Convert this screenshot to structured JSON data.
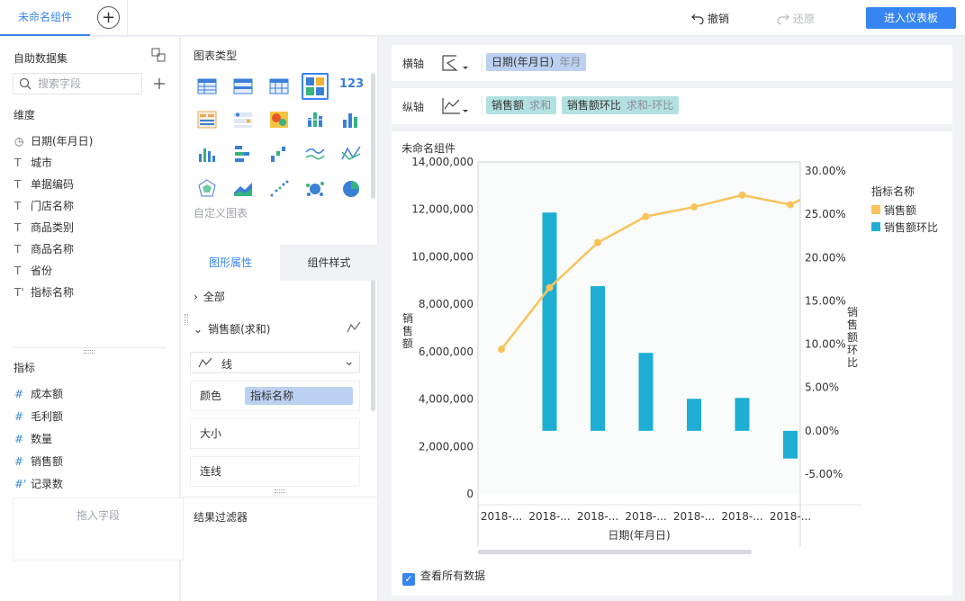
{
  "topbar": {
    "tab_label": "未命名组件",
    "add_tab": "+",
    "undo": "撤销",
    "redo": "还原",
    "enter_dashboard": "进入仪表板"
  },
  "dataset": {
    "title": "自助数据集",
    "search_placeholder": "搜索字段",
    "dimensions_title": "维度",
    "dimensions": [
      {
        "icon": "clock-icon",
        "label": "日期(年月日)"
      },
      {
        "icon": "text-icon",
        "label": "城市"
      },
      {
        "icon": "text-icon",
        "label": "单据编码"
      },
      {
        "icon": "text-icon",
        "label": "门店名称"
      },
      {
        "icon": "text-icon",
        "label": "商品类别"
      },
      {
        "icon": "text-icon",
        "label": "商品名称"
      },
      {
        "icon": "text-icon",
        "label": "省份"
      },
      {
        "icon": "text-icon",
        "label": "指标名称"
      }
    ],
    "measures_title": "指标",
    "measures": [
      {
        "icon": "hash-icon",
        "label": "成本额"
      },
      {
        "icon": "hash-icon",
        "label": "毛利额"
      },
      {
        "icon": "hash-icon",
        "label": "数量"
      },
      {
        "icon": "hash-icon",
        "label": "销售额"
      },
      {
        "icon": "hash-icon",
        "label": "记录数"
      }
    ]
  },
  "chart_types": {
    "title": "图表类型",
    "custom_label": "自定义图表"
  },
  "properties": {
    "tab_shape": "图形属性",
    "tab_style": "组件样式",
    "all": "全部",
    "measure_item": "销售额(求和)",
    "mark_type": "线",
    "color_label": "颜色",
    "color_pill": "指标名称",
    "size_label": "大小",
    "line_label": "连线"
  },
  "result_filter": {
    "title": "结果过滤器",
    "drop_hint": "拖入字段"
  },
  "axes": {
    "x_label": "横轴",
    "x_pill": "日期(年月日)",
    "x_pill_sub": "年月",
    "y_label": "纵轴",
    "y_pills": [
      {
        "label": "销售额",
        "sub": "求和"
      },
      {
        "label": "销售额环比",
        "sub": "求和-环比"
      }
    ]
  },
  "widget": {
    "title": "未命名组件",
    "show_all_data": "查看所有数据"
  },
  "colors": {
    "accent": "#3685f2",
    "bar": "#1eaed3",
    "line": "#f8c35b"
  },
  "chart_data": {
    "type": "bar",
    "x": [
      "2018-...",
      "2018-...",
      "2018-...",
      "2018-...",
      "2018-...",
      "2018-...",
      "2018-..."
    ],
    "xlabel": "日期(年月日)",
    "ylabel_left": "销售额",
    "ylabel_right": "销售额环比",
    "left_ticks": [
      "14,000,000",
      "12,000,000",
      "10,000,000",
      "8,000,000",
      "6,000,000",
      "4,000,000",
      "2,000,000",
      "0"
    ],
    "right_ticks": [
      "30.00%",
      "25.00%",
      "20.00%",
      "15.00%",
      "10.00%",
      "5.00%",
      "0.00%",
      "-5.00%"
    ],
    "ylim_left": [
      0,
      14000000
    ],
    "ylim_right": [
      -0.05,
      0.3
    ],
    "legend_title": "指标名称",
    "legend_position": "right",
    "series": [
      {
        "name": "销售额",
        "type": "line",
        "axis": "left",
        "color": "#f8c35b",
        "values": [
          6100000,
          8700000,
          10600000,
          11700000,
          12100000,
          12600000,
          12200000,
          13200000
        ]
      },
      {
        "name": "销售额环比",
        "type": "bar",
        "axis": "right",
        "color": "#1eaed3",
        "values": [
          0.252,
          0.167,
          0.09,
          0.037,
          0.038,
          -0.032
        ]
      }
    ]
  }
}
